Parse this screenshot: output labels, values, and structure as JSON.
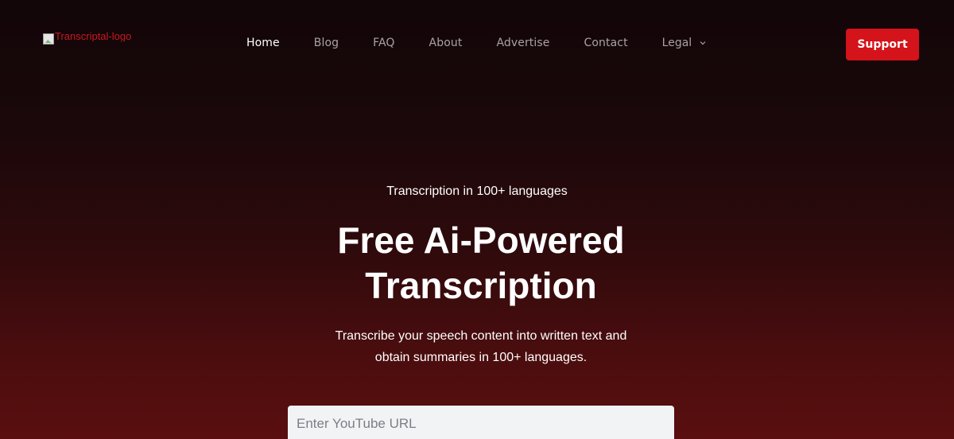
{
  "header": {
    "logo_alt": "Transcriptal-logo",
    "nav": [
      {
        "label": "Home",
        "active": true
      },
      {
        "label": "Blog",
        "active": false
      },
      {
        "label": "FAQ",
        "active": false
      },
      {
        "label": "About",
        "active": false
      },
      {
        "label": "Advertise",
        "active": false
      },
      {
        "label": "Contact",
        "active": false
      }
    ],
    "legal_label": "Legal",
    "support_label": "Support"
  },
  "hero": {
    "eyebrow": "Transcription in 100+ languages",
    "title_line1": "Free Ai-Powered",
    "title_line2": "Transcription",
    "subtitle_line1": "Transcribe your speech content into written text and",
    "subtitle_line2": "obtain summaries in 100+ languages.",
    "url_placeholder": "Enter YouTube URL"
  },
  "colors": {
    "accent": "#d4131a",
    "background_top": "#120608",
    "background_bottom": "#5a0e0f"
  }
}
